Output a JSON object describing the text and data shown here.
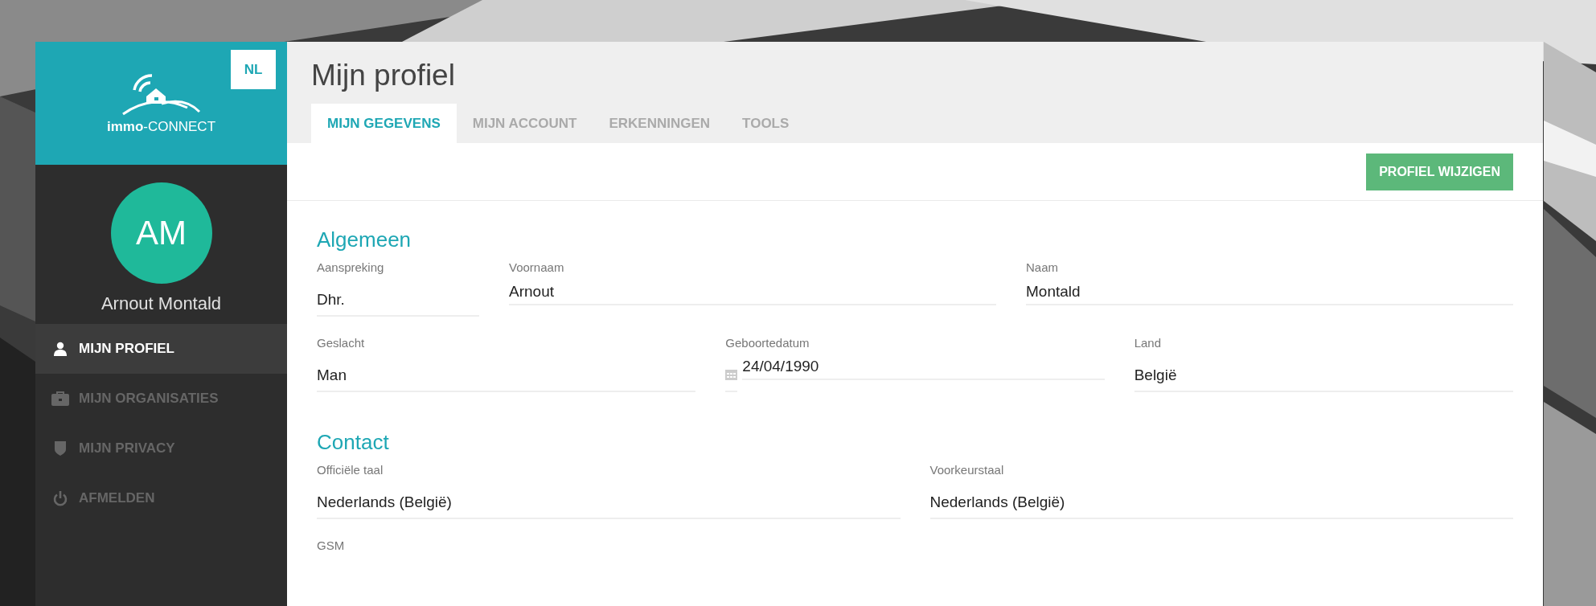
{
  "sidebar": {
    "language_button": "NL",
    "logo_text": "**immo**-CONNECT",
    "user": {
      "initials": "AM",
      "name": "Arnout Montald"
    },
    "nav": [
      {
        "label": "MIJN PROFIEL",
        "kind": "user",
        "selected": true
      },
      {
        "label": "MIJN ORGANISATIES",
        "kind": "briefcase",
        "selected": false
      },
      {
        "label": "MIJN PRIVACY",
        "kind": "shield",
        "selected": false
      },
      {
        "label": "AFMELDEN",
        "kind": "power",
        "selected": false
      }
    ]
  },
  "page": {
    "title": "Mijn profiel",
    "tabs": [
      {
        "label": "MIJN GEGEVENS",
        "selected": true
      },
      {
        "label": "MIJN ACCOUNT",
        "selected": false
      },
      {
        "label": "ERKENNINGEN",
        "selected": false
      },
      {
        "label": "TOOLS",
        "selected": false
      }
    ],
    "action_button": "PROFIEL WIJZIGEN",
    "sections": [
      {
        "title": "Algemeen",
        "rows": [
          [
            {
              "label": "Aanspreking",
              "value": "Dhr.",
              "kind": "select"
            },
            {
              "label": "Voornaam",
              "value": "Arnout",
              "kind": "text"
            },
            {
              "label": "Naam",
              "value": "Montald",
              "kind": "text"
            }
          ],
          [
            {
              "label": "Geslacht",
              "value": "Man",
              "kind": "select"
            },
            {
              "label": "Geboortedatum",
              "value": "24/04/1990",
              "kind": "date"
            },
            {
              "label": "Land",
              "value": "België",
              "kind": "select"
            }
          ]
        ]
      },
      {
        "title": "Contact",
        "rows": [
          [
            {
              "label": "Officiële taal",
              "value": "Nederlands (België)",
              "kind": "select"
            },
            {
              "label": "Voorkeurstaal",
              "value": "Nederlands (België)",
              "kind": "select"
            }
          ],
          [
            {
              "label": "GSM",
              "kind": "text"
            }
          ]
        ]
      }
    ]
  }
}
